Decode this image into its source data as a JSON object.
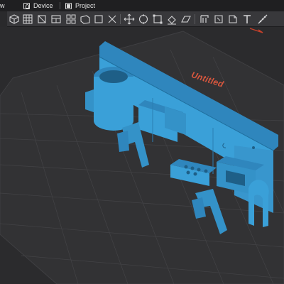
{
  "menubar": {
    "tabs": [
      {
        "label": "w",
        "icon": "partial-tab-icon"
      },
      {
        "label": "Device",
        "icon": "device-icon"
      },
      {
        "label": "Project",
        "icon": "project-icon"
      }
    ]
  },
  "toolbar": {
    "icons": [
      "view-cube-icon",
      "grid-arrange-icon",
      "orient-icon",
      "layout-icon",
      "move-icon",
      "rotate-icon",
      "scale-icon",
      "lay-on-face-icon",
      "cut-icon",
      "split-icon",
      "support-paint-icon",
      "seam-paint-icon",
      "color-paint-icon",
      "text-icon",
      "measure-icon"
    ]
  },
  "viewport": {
    "plate_name": "Untitled"
  },
  "colors": {
    "model": "#3aa0d8",
    "plate": "#333335",
    "plate_label": "#d9573e",
    "background": "#2a2a2c"
  }
}
